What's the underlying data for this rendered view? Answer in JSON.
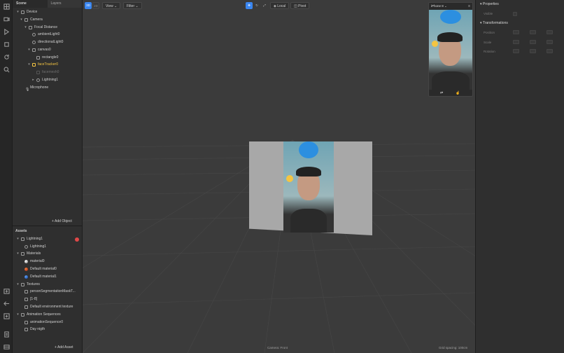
{
  "left_tabs": {
    "scene": "Scene",
    "layers": "Layers"
  },
  "scene_tree": [
    {
      "label": "Device",
      "icon": "device-icon"
    },
    {
      "label": "Camera",
      "icon": "camera-icon"
    },
    {
      "label": "Focal Distance",
      "icon": "focal-icon"
    },
    {
      "label": "ambientLight0",
      "icon": "light-icon"
    },
    {
      "label": "directionalLight0",
      "icon": "light-icon"
    },
    {
      "label": "canvas0",
      "icon": "canvas-icon"
    },
    {
      "label": "rectangle0",
      "icon": "rectangle-icon"
    },
    {
      "label": "faceTracker0",
      "icon": "face-tracker-icon"
    },
    {
      "label": "facemesh0",
      "icon": "mesh-icon"
    },
    {
      "label": "Lightning1",
      "icon": "object-icon"
    },
    {
      "label": "Microphone",
      "icon": "microphone-icon"
    }
  ],
  "add_object": "Add Object",
  "assets_title": "Assets",
  "assets_tree": [
    {
      "label": "Lightning1"
    },
    {
      "label": "Lightning1"
    },
    {
      "label": "Materials"
    },
    {
      "label": "material0"
    },
    {
      "label": "Default material0"
    },
    {
      "label": "Default material1"
    },
    {
      "label": "Textures"
    },
    {
      "label": "personSegmentationMaskT..."
    },
    {
      "label": "[1-8]"
    },
    {
      "label": "Default environment texture"
    },
    {
      "label": "Animation Sequences"
    },
    {
      "label": "animationSequence0"
    },
    {
      "label": "Day nigth"
    }
  ],
  "add_asset": "Add Asset",
  "toolbar": {
    "mode_3d": "3D",
    "mode_2d": "2D",
    "view": "View",
    "filter": "Filter",
    "local": "Local",
    "pivot": "Pivot",
    "device": "iPhone 8"
  },
  "viewport": {
    "camera_label": "Camera: Front",
    "grid_label": "Grid spacing: 100cm"
  },
  "right_panel": {
    "properties": "Properties",
    "visible": "Visible",
    "transformations": "Transformations",
    "position": "Position",
    "scale": "Scale",
    "rotation": "Rotation"
  },
  "colors": {
    "accent": "#3a86f0",
    "highlight": "#f5c542",
    "error": "#e04848"
  }
}
